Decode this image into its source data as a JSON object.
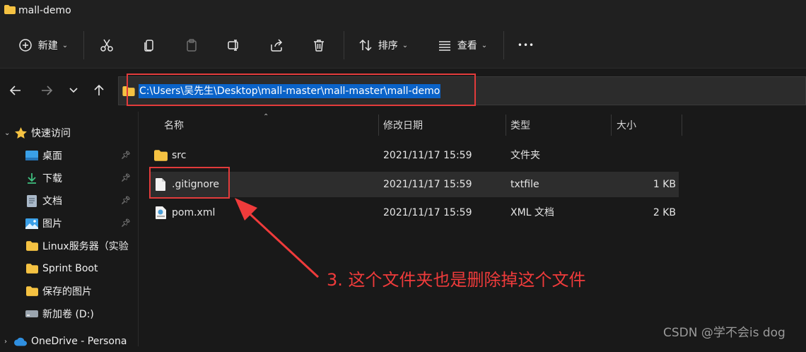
{
  "window": {
    "title": "mall-demo"
  },
  "toolbar": {
    "new_label": "新建",
    "sort_label": "排序",
    "view_label": "查看",
    "more_label": "•••"
  },
  "address": {
    "path": "C:\\Users\\吴先生\\Desktop\\mall-master\\mall-master\\mall-demo"
  },
  "sidebar": {
    "items": [
      {
        "label": "快速访问"
      },
      {
        "label": "桌面"
      },
      {
        "label": "下载"
      },
      {
        "label": "文档"
      },
      {
        "label": "图片"
      },
      {
        "label": "Linux服务器（实验"
      },
      {
        "label": "Sprint Boot"
      },
      {
        "label": "保存的图片"
      },
      {
        "label": "新加卷 (D:)"
      },
      {
        "label": "OneDrive - Persona"
      }
    ]
  },
  "columns": {
    "name": "名称",
    "modified": "修改日期",
    "type": "类型",
    "size": "大小"
  },
  "files": [
    {
      "name": "src",
      "modified": "2021/11/17 15:59",
      "type": "文件夹",
      "size": ""
    },
    {
      "name": ".gitignore",
      "modified": "2021/11/17 15:59",
      "type": "txtfile",
      "size": "1 KB"
    },
    {
      "name": "pom.xml",
      "modified": "2021/11/17 15:59",
      "type": "XML 文档",
      "size": "2 KB"
    }
  ],
  "annotation": {
    "text": "3. 这个文件夹也是删除掉这个文件"
  },
  "watermark": {
    "text": "CSDN @学不会is dog"
  },
  "colors": {
    "accent": "#0a63c9",
    "annotation": "#e23b3b",
    "folder": "#f5c242"
  }
}
